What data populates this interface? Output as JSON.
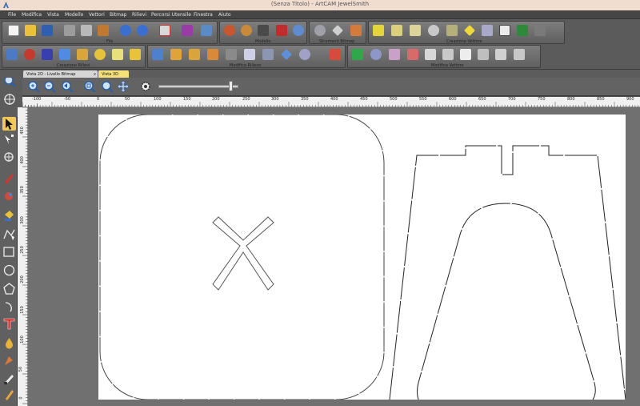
{
  "window": {
    "title": "(Senza Titolo) - ArtCAM JewelSmith"
  },
  "menu": [
    "File",
    "Modifica",
    "Vista",
    "Modello",
    "Vettori",
    "Bitmap",
    "Rilievi",
    "Percorsi Utensile",
    "Finestra",
    "Aiuto"
  ],
  "toolbar_labels": {
    "file": "File",
    "modello": "Modello",
    "strumenti_bitmap": "Strumenti Bitmap",
    "creazione_vettore": "Creazione Vettore",
    "creazione_rilievi": "Creazione Rilievi",
    "modifica_rilievo": "Modifica Rilievo",
    "modifica_vettore": "Modifica Vettore"
  },
  "tabs": {
    "view2d": "Vista 2D - Livello Bitmap",
    "view2d_close": "x",
    "view3d": "Vista 3D"
  },
  "ruler": {
    "h": [
      "-100",
      "-50",
      "0",
      "50",
      "100",
      "150",
      "200",
      "250",
      "300",
      "350",
      "400",
      "450",
      "500",
      "550",
      "600",
      "650",
      "700",
      "750",
      "800",
      "850",
      "900"
    ],
    "v": [
      "450",
      "400",
      "350",
      "300",
      "250",
      "200",
      "150",
      "100",
      "50",
      "0"
    ]
  },
  "colors": {
    "background": "#4b4b4b",
    "panel": "#5b5b5b",
    "sheet": "#ffffff",
    "active_tab": "#d6d6d6",
    "inactive_tab": "#f5e07a",
    "titlebar": "#f0ddd0"
  },
  "icons": {
    "file": [
      "new-file-icon",
      "open-folder-icon",
      "save-icon",
      "cut-icon",
      "copy-icon",
      "paste-icon",
      "undo-icon",
      "redo-icon",
      "wizard-icon",
      "book-icon",
      "import-icon"
    ],
    "modello": [
      "relief-bear-icon",
      "teddy-icon",
      "jar-icon",
      "gnome-icon",
      "sphere-mesh-icon"
    ],
    "bitmap": [
      "eraser-icon",
      "diamond-outline-icon",
      "brush-tools-icon"
    ],
    "vector": [
      "star-cursor-icon",
      "node-cursor-icon",
      "chain-icon",
      "arc-icon",
      "scissors-icon",
      "diamond-yellow-icon",
      "fan-icon",
      "nrs-text-icon",
      "grid-icon",
      "layers-icon"
    ],
    "rilievi": [
      "node-layers-icon",
      "droplet-icon",
      "star-relief-icon",
      "gem-blue-icon",
      "s-curve-icon",
      "coil-icon",
      "stack-icon",
      "yellow-layer-icon"
    ],
    "mod_rilievo": [
      "blue-slab-icon",
      "sprinkle-icon",
      "cup-icon",
      "stud-icon",
      "person-icon",
      "tub-icon",
      "column-icon",
      "box-icon",
      "ring-icon",
      "pen-icon"
    ],
    "mod_vettore": [
      "green-cross-icon",
      "pot-icon",
      "frame-icon",
      "wave-icon",
      "bracket-icon",
      "grid-edit-icon",
      "polygon-icon",
      "curve-icon",
      "join-icon",
      "offset-icon"
    ]
  }
}
